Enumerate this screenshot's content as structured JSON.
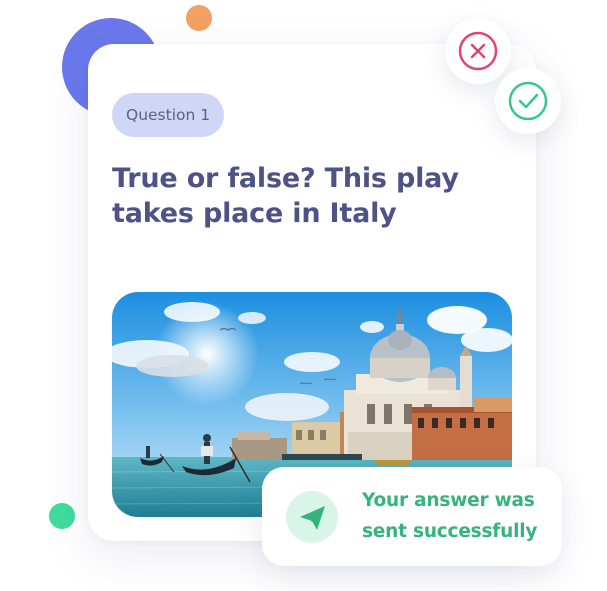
{
  "question_card": {
    "label": "Question 1",
    "prompt": "True or false? This play takes place in Italy",
    "image_subject": "Venice canal with gondolas and domed basilica"
  },
  "answer_actions": {
    "false_icon": "close-icon",
    "true_icon": "check-icon"
  },
  "notification": {
    "icon": "paper-plane-icon",
    "message": "Your answer was sent successfully"
  },
  "colors": {
    "accent_blue": "#6a78ec",
    "accent_orange": "#f4a062",
    "accent_green": "#3fdc9c",
    "question_text": "#4d5287",
    "pill_background": "#cfd6f6",
    "false_red": "#e04475",
    "true_green": "#35c88a",
    "success_text": "#35b47d"
  }
}
